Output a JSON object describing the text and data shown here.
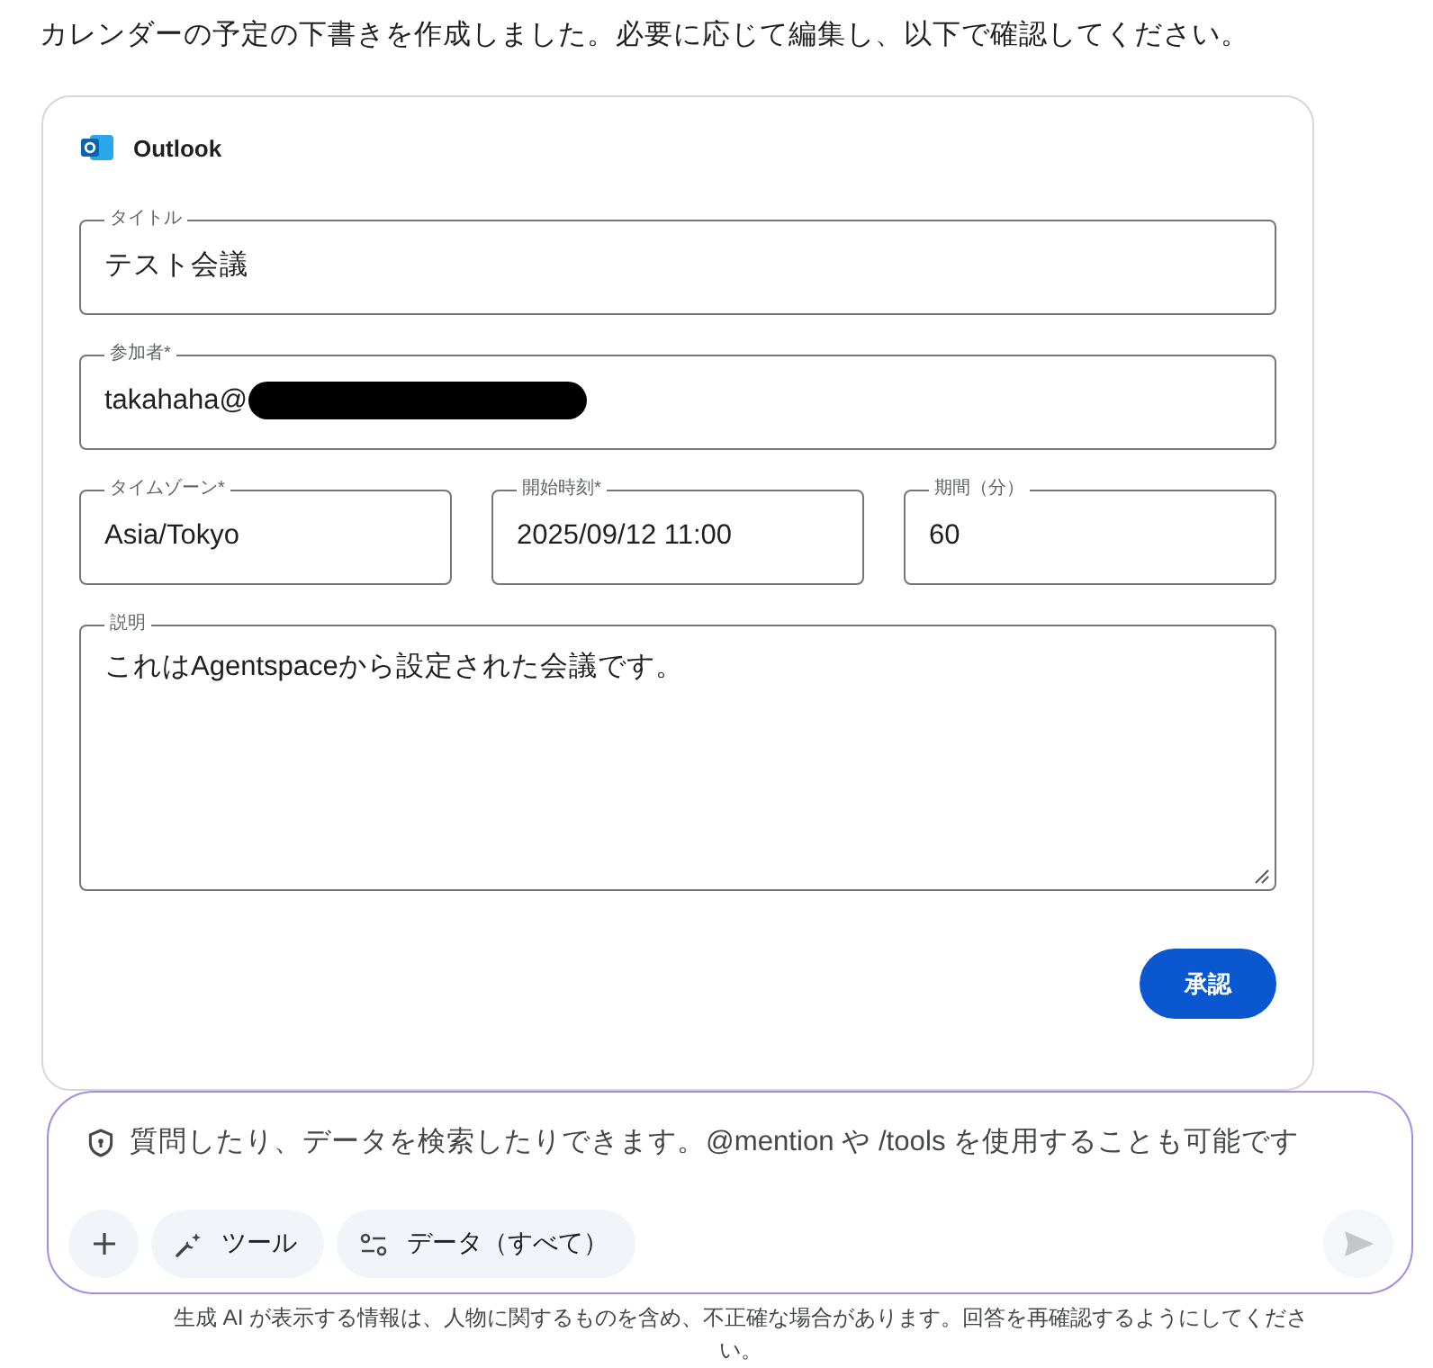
{
  "message": "カレンダーの予定の下書きを作成しました。必要に応じて編集し、以下で確認してください。",
  "card": {
    "app": {
      "name": "Outlook"
    },
    "rows": [
      {
        "fields": [
          {
            "kind": "text",
            "label": "タイトル",
            "value": "テスト会議",
            "redacted": false
          }
        ]
      },
      {
        "fields": [
          {
            "kind": "text",
            "label": "参加者*",
            "value": "takahaha@",
            "redacted": true
          }
        ]
      },
      {
        "fields": [
          {
            "kind": "text",
            "label": "タイムゾーン*",
            "value": "Asia/Tokyo",
            "redacted": false
          },
          {
            "kind": "text",
            "label": "開始時刻*",
            "value": "2025/09/12 11:00",
            "redacted": false
          },
          {
            "kind": "text",
            "label": "期間（分）",
            "value": "60",
            "redacted": false
          }
        ]
      },
      {
        "fields": [
          {
            "kind": "textarea",
            "label": "説明",
            "value": "これはAgentspaceから設定された会議です。",
            "redacted": false
          }
        ]
      }
    ],
    "approve_button": {
      "label": "承認"
    }
  },
  "chat": {
    "placeholder": "質問したり、データを検索したりできます。@mention や /tools を使用することも可能です",
    "tools": [
      {
        "kind": "add"
      },
      {
        "kind": "tools",
        "label": "ツール"
      },
      {
        "kind": "data",
        "label": "データ（すべて）"
      }
    ],
    "send_button": {
      "disabled": true
    }
  },
  "disclaimer": "生成 AI が表示する情報は、人物に関するものを含め、不正確な場合があります。回答を再確認するようにしてください。"
}
